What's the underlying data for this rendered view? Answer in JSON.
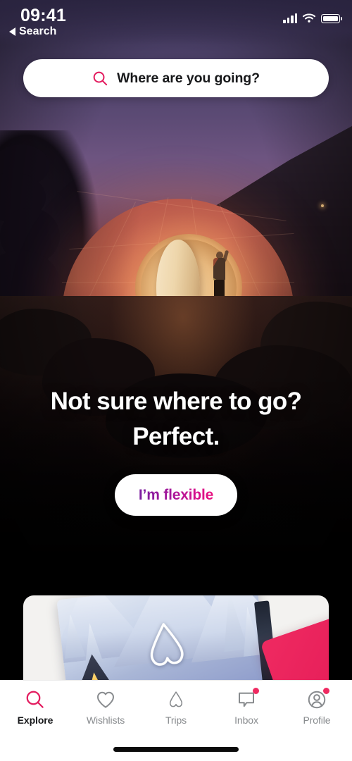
{
  "status_bar": {
    "time": "09:41",
    "back_label": "Search",
    "back_icon": "triangle-left-icon",
    "signal_icon": "cellular-signal-icon",
    "wifi_icon": "wifi-icon",
    "battery_icon": "battery-full-icon"
  },
  "search": {
    "icon": "search-icon",
    "placeholder": "Where are you going?",
    "icon_color": "#E31C5F"
  },
  "hero": {
    "headline_line1": "Not sure where to go?",
    "headline_line2": "Perfect.",
    "cta_label": "I’m flexible",
    "cta_gradient_start": "#7A1FA0",
    "cta_gradient_end": "#E8117F"
  },
  "promo_card": {
    "logo_icon": "airbnb-belo-icon",
    "accent_color": "#E61E59"
  },
  "tabbar": {
    "items": [
      {
        "label": "Explore",
        "icon": "search-icon",
        "active": true,
        "badge": false
      },
      {
        "label": "Wishlists",
        "icon": "heart-icon",
        "active": false,
        "badge": false
      },
      {
        "label": "Trips",
        "icon": "airbnb-belo-icon",
        "active": false,
        "badge": false
      },
      {
        "label": "Inbox",
        "icon": "chat-bubble-icon",
        "active": false,
        "badge": true
      },
      {
        "label": "Profile",
        "icon": "user-circle-icon",
        "active": false,
        "badge": true
      }
    ],
    "active_color": "#E31C5F",
    "inactive_color": "#888B8E",
    "badge_color": "#EF2A61"
  },
  "home_indicator": "home-indicator-bar"
}
